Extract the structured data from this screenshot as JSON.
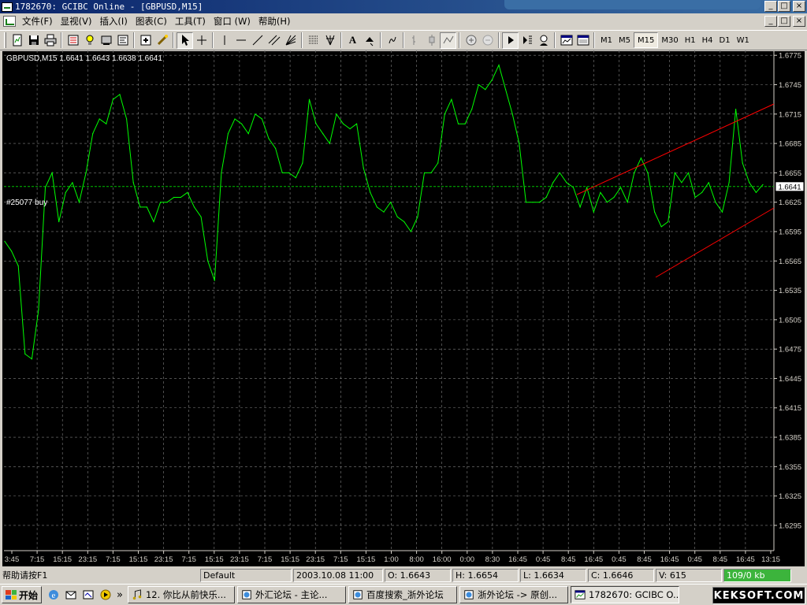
{
  "window": {
    "title": "1782670: GCIBC Online - [GBPUSD,M15]",
    "controls": [
      "_",
      "□",
      "×"
    ]
  },
  "menu": {
    "items": [
      "文件(F)",
      "显视(V)",
      "插入(I)",
      "图表(C)",
      "工具(T)",
      "窗口 (W)",
      "帮助(H)"
    ]
  },
  "toolbar": {
    "text_tool": "A",
    "timeframes": [
      "M1",
      "M5",
      "M15",
      "M30",
      "H1",
      "H4",
      "D1",
      "W1"
    ],
    "active_timeframe": "M15"
  },
  "chart": {
    "header": "GBPUSD,M15  1.6641 1.6643 1.6638 1.6641",
    "order_label": "#25077 buy",
    "bid_label": "1.6641",
    "colors": {
      "background": "#000000",
      "price_line": "#00ff00",
      "grid": "#808080",
      "trend_line": "#ff0000",
      "axis_text": "#d4d0c8"
    }
  },
  "chart_data": {
    "type": "line",
    "title": "GBPUSD,M15",
    "ylim": [
      1.627,
      1.678
    ],
    "y_ticks": [
      "1.6775",
      "1.6745",
      "1.6715",
      "1.6685",
      "1.6655",
      "1.6625",
      "1.6595",
      "1.6565",
      "1.6535",
      "1.6505",
      "1.6475",
      "1.6445",
      "1.6415",
      "1.6385",
      "1.6355",
      "1.6325",
      "1.6295"
    ],
    "x_ticks": [
      "3:45",
      "7:15",
      "15:15",
      "23:15",
      "7:15",
      "15:15",
      "23:15",
      "7:15",
      "15:15",
      "23:15",
      "7:15",
      "15:15",
      "23:15",
      "7:15",
      "15:15",
      "1:00",
      "8:00",
      "16:00",
      "0:00",
      "8:30",
      "16:45",
      "0:45",
      "8:45",
      "16:45",
      "0:45",
      "8:45",
      "16:45",
      "0:45",
      "8:45",
      "16:45",
      "13:15"
    ],
    "series": [
      {
        "values": [
          1.6585,
          1.6575,
          1.656,
          1.647,
          1.6465,
          1.6515,
          1.664,
          1.6655,
          1.6605,
          1.6635,
          1.6645,
          1.6625,
          1.6655,
          1.6695,
          1.671,
          1.6705,
          1.673,
          1.6735,
          1.671,
          1.6645,
          1.662,
          1.662,
          1.6605,
          1.6625,
          1.6625,
          1.663,
          1.663,
          1.6635,
          1.662,
          1.661,
          1.6565,
          1.6545,
          1.6655,
          1.6695,
          1.671,
          1.6705,
          1.6695,
          1.6715,
          1.671,
          1.669,
          1.668,
          1.6655,
          1.6655,
          1.665,
          1.6665,
          1.673,
          1.6705,
          1.6695,
          1.6685,
          1.6715,
          1.6705,
          1.67,
          1.6705,
          1.666,
          1.6635,
          1.662,
          1.6615,
          1.6625,
          1.661,
          1.6605,
          1.6595,
          1.661,
          1.6655,
          1.6655,
          1.6665,
          1.6715,
          1.673,
          1.6705,
          1.6705,
          1.672,
          1.6745,
          1.674,
          1.675,
          1.6765,
          1.674,
          1.6715,
          1.6685,
          1.6625,
          1.6625,
          1.6625,
          1.663,
          1.6645,
          1.6655,
          1.6645,
          1.664,
          1.662,
          1.664,
          1.6615,
          1.6635,
          1.6625,
          1.663,
          1.664,
          1.6625,
          1.6655,
          1.667,
          1.6655,
          1.6615,
          1.66,
          1.6605,
          1.6655,
          1.6645,
          1.6655,
          1.663,
          1.6635,
          1.6645,
          1.6625,
          1.6615,
          1.6645,
          1.672,
          1.6665,
          1.6645,
          1.6635,
          1.6643
        ]
      }
    ],
    "annotations": {
      "order_level": 1.6641,
      "bid": 1.6641
    }
  },
  "statusbar": {
    "help": "帮助请按F1",
    "profile": "Default",
    "time": "2003.10.08 11:00",
    "open": "O: 1.6643",
    "high": "H: 1.6654",
    "low": "L: 1.6634",
    "close": "C: 1.6646",
    "volume": "V: 615",
    "connection": "109/0 kb"
  },
  "taskbar": {
    "start": "开始",
    "more": "»",
    "tasks": [
      {
        "label": "12. 你比从前快乐..."
      },
      {
        "label": "外汇论坛 - 主论..."
      },
      {
        "label": "百度搜索_浙外论坛"
      },
      {
        "label": "浙外论坛 -> 原创..."
      },
      {
        "label": "1782670: GCIBC O..."
      }
    ],
    "tray_text": "KEKSOFT.COM"
  }
}
